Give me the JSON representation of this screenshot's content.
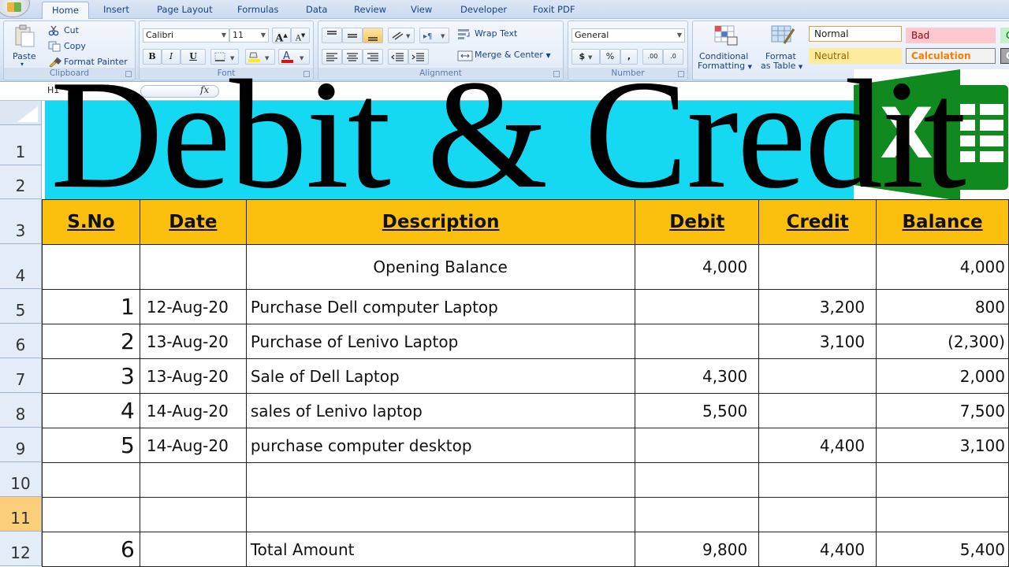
{
  "ribbon": {
    "tabs": [
      "Home",
      "Insert",
      "Page Layout",
      "Formulas",
      "Data",
      "Review",
      "View",
      "Developer",
      "Foxit PDF"
    ],
    "active_tab": "Home",
    "clipboard": {
      "paste": "Paste",
      "cut": "Cut",
      "copy": "Copy",
      "format_painter": "Format Painter",
      "label": "Clipboard"
    },
    "font": {
      "font_name": "Calibri",
      "font_size": "11",
      "bold": "B",
      "italic": "I",
      "underline": "U",
      "grow": "A",
      "shrink": "A",
      "label": "Font"
    },
    "alignment": {
      "wrap_text": "Wrap Text",
      "merge_center": "Merge & Center",
      "label": "Alignment"
    },
    "number": {
      "format": "General",
      "currency": "$",
      "percent": "%",
      "comma": ",",
      "inc_decimal": ".00",
      "dec_decimal": ".0",
      "label": "Number"
    },
    "styles": {
      "conditional_formatting_1": "Conditional",
      "conditional_formatting_2": "Formatting",
      "format_as_table_1": "Format",
      "format_as_table_2": "as Table",
      "cells": [
        {
          "label": "Normal",
          "bg": "#ffffff",
          "color": "#222222",
          "border": "#e0a040"
        },
        {
          "label": "Bad",
          "bg": "#ffc7ce",
          "color": "#9c0006",
          "border": "#ffc7ce"
        },
        {
          "label": "G",
          "bg": "#c6efce",
          "color": "#006100",
          "border": "#c6efce"
        },
        {
          "label": "Neutral",
          "bg": "#ffeb9c",
          "color": "#9c6500",
          "border": "#ffeb9c"
        },
        {
          "label": "Calculation",
          "bg": "#f2f2f2",
          "color": "#fa7d00",
          "border": "#7f7f7f"
        },
        {
          "label": "C",
          "bg": "#a5a5a5",
          "color": "#ffffff",
          "border": "#3f3f3f"
        }
      ]
    }
  },
  "formula_bar": {
    "name_box": "H1",
    "fx": "fx",
    "content": ""
  },
  "sheet": {
    "title": "Debit & Credit",
    "title_bg": "#15d9f3",
    "header_bg": "#fbbf0d",
    "row_numbers": [
      "1",
      "2",
      "3",
      "4",
      "5",
      "6",
      "7",
      "8",
      "9",
      "10",
      "11",
      "12"
    ],
    "active_row": "11",
    "columns": [
      "S.No",
      "Date",
      "Description",
      "Debit",
      "Credit",
      "Balance"
    ],
    "rows": [
      {
        "sno": "",
        "date": "",
        "description": "Opening Balance",
        "debit": "4,000",
        "credit": "",
        "balance": "4,000"
      },
      {
        "sno": "1",
        "date": "12-Aug-20",
        "description": "Purchase Dell computer Laptop",
        "debit": "",
        "credit": "3,200",
        "balance": "800"
      },
      {
        "sno": "2",
        "date": "13-Aug-20",
        "description": "Purchase of Lenivo Laptop",
        "debit": "",
        "credit": "3,100",
        "balance": "(2,300)"
      },
      {
        "sno": "3",
        "date": "13-Aug-20",
        "description": "Sale of Dell Laptop",
        "debit": "4,300",
        "credit": "",
        "balance": "2,000"
      },
      {
        "sno": "4",
        "date": "14-Aug-20",
        "description": "sales of Lenivo laptop",
        "debit": "5,500",
        "credit": "",
        "balance": "7,500"
      },
      {
        "sno": "5",
        "date": "14-Aug-20",
        "description": "purchase computer desktop",
        "debit": "",
        "credit": "4,400",
        "balance": "3,100"
      },
      {
        "sno": "",
        "date": "",
        "description": "",
        "debit": "",
        "credit": "",
        "balance": ""
      },
      {
        "sno": "",
        "date": "",
        "description": "",
        "debit": "",
        "credit": "",
        "balance": ""
      },
      {
        "sno": "6",
        "date": "",
        "description": "Total Amount",
        "debit": "9,800",
        "credit": "4,400",
        "balance": "5,400"
      }
    ]
  },
  "logo": {
    "name": "excel-logo",
    "letter": "X",
    "color": "#107c10"
  }
}
